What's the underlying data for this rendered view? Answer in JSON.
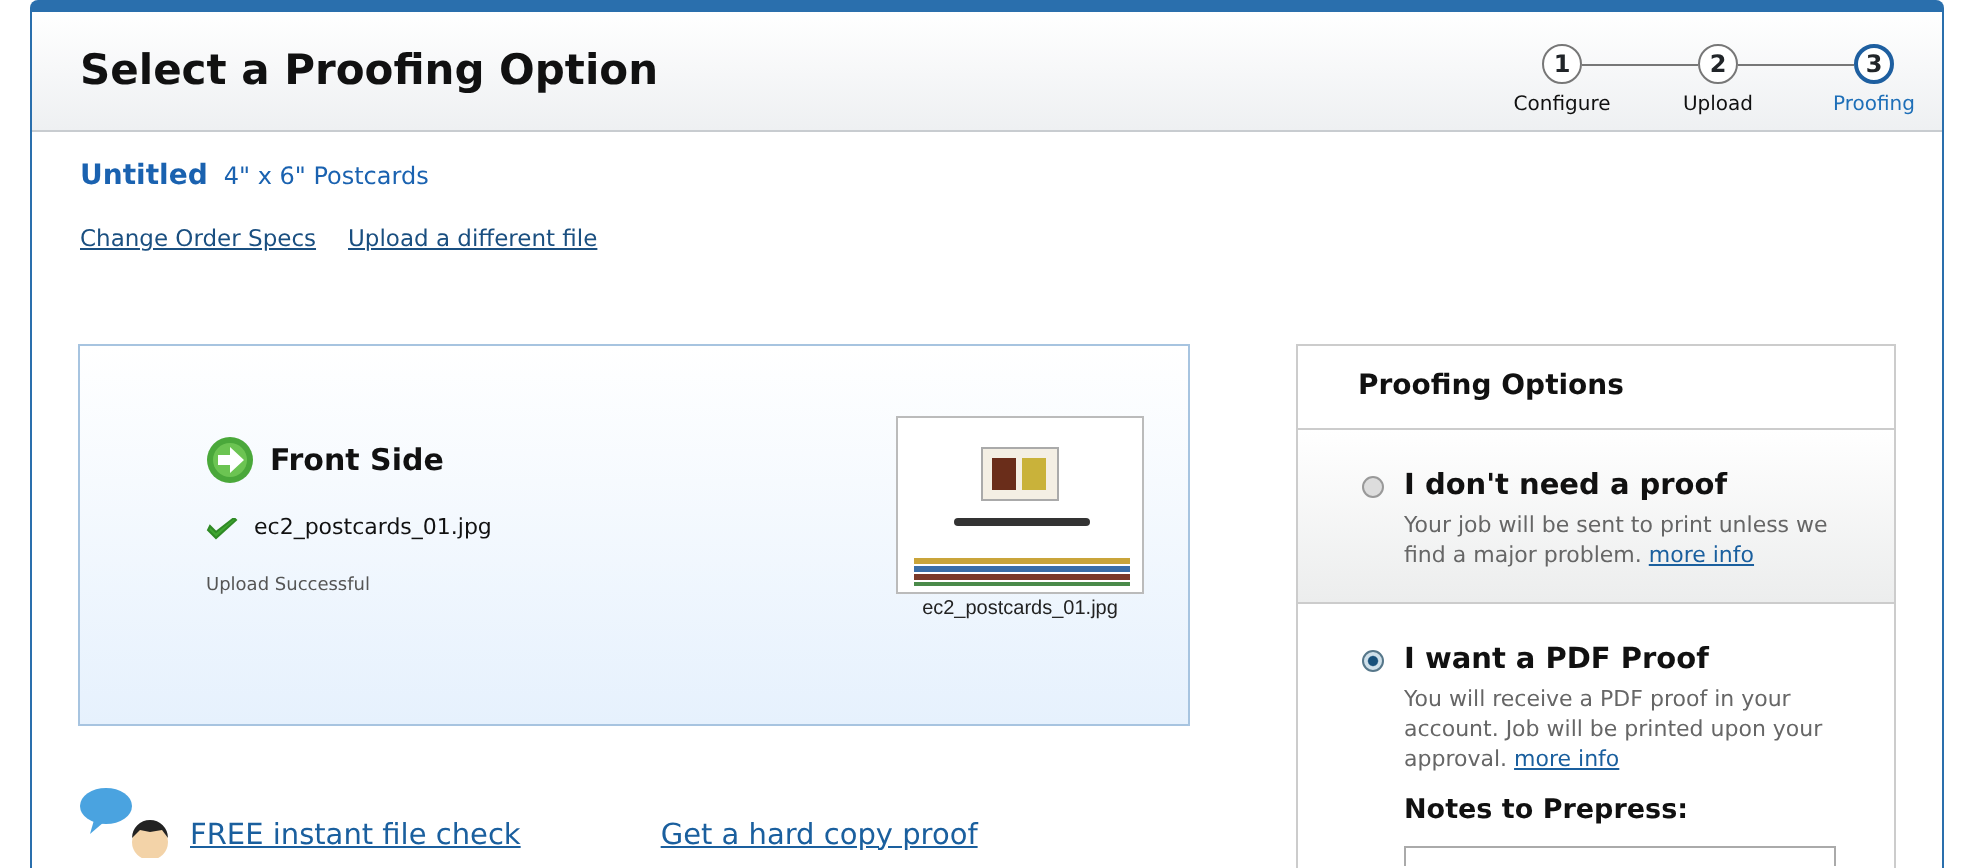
{
  "header": {
    "title": "Select a Proofing Option"
  },
  "steps": [
    {
      "number": "1",
      "label": "Configure",
      "selected": false
    },
    {
      "number": "2",
      "label": "Upload",
      "selected": false
    },
    {
      "number": "3",
      "label": "Proofing",
      "selected": true
    }
  ],
  "order": {
    "name": "Untitled",
    "product": "4\" x 6\" Postcards",
    "links": [
      "Change Order Specs",
      "Upload a different file"
    ]
  },
  "upload": {
    "side": "Front Side",
    "file_name": "ec2_postcards_01.jpg",
    "status": "Upload Successful",
    "thumbnail": {
      "kind": "picture",
      "caption": "ec2_postcards_01.jpg"
    }
  },
  "help_links": [
    {
      "label": "FREE instant file check"
    },
    {
      "label": "Get a hard copy proof"
    }
  ],
  "proofing_options": {
    "title": "Proofing Options",
    "options": [
      {
        "title": "I don't need a proof",
        "description": "Your job will be sent to print unless we find a major problem.",
        "link": "more info",
        "selected": false
      },
      {
        "title": "I want a PDF Proof",
        "description": "You will receive a PDF proof in your account. Job will be printed upon your approval.",
        "link": "more info",
        "selected": true
      }
    ],
    "notes_label": "Notes to Prepress:"
  }
}
